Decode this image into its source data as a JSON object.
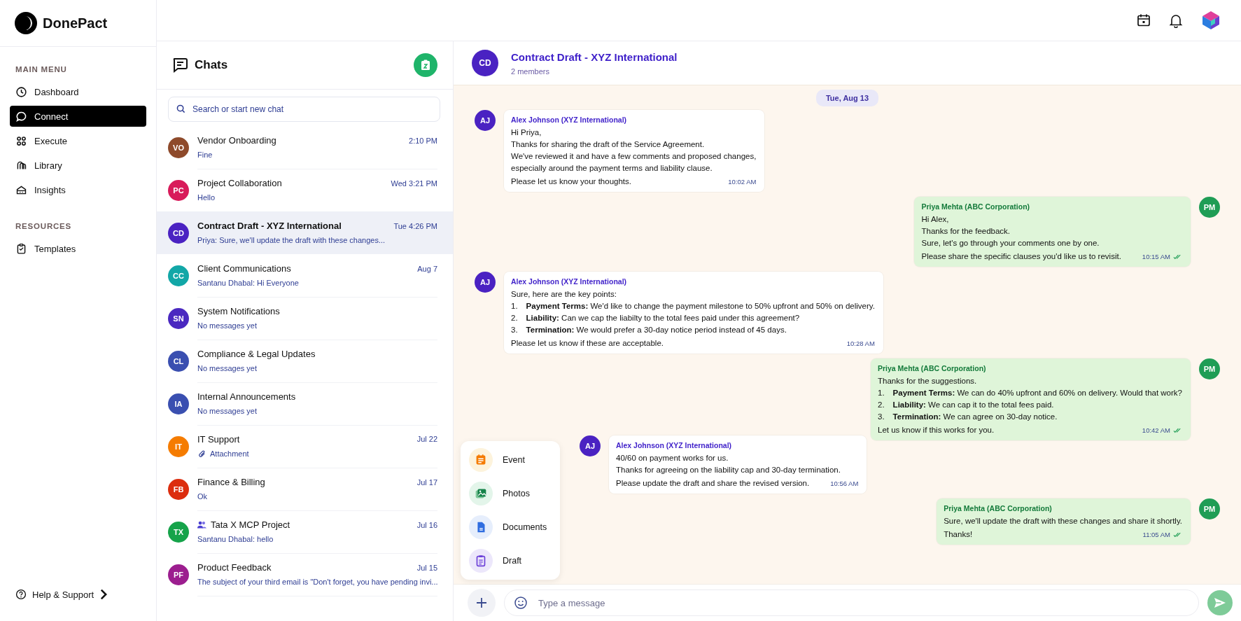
{
  "brand": {
    "name": "DonePact"
  },
  "sidebar": {
    "sections": [
      {
        "title": "MAIN MENU",
        "items": [
          {
            "label": "Dashboard",
            "selected": false
          },
          {
            "label": "Connect",
            "selected": true
          },
          {
            "label": "Execute",
            "selected": false
          },
          {
            "label": "Library",
            "selected": false
          },
          {
            "label": "Insights",
            "selected": false
          }
        ]
      },
      {
        "title": "RESOURCES",
        "items": [
          {
            "label": "Templates",
            "selected": false
          }
        ]
      }
    ],
    "help": "Help & Support"
  },
  "chat_list": {
    "title": "Chats",
    "search": {
      "placeholder": "Search or start new chat"
    },
    "chats": [
      {
        "initials": "VO",
        "color": "#8e4a2b",
        "name": "Vendor Onboarding",
        "time": "2:10 PM",
        "preview": "Fine",
        "kind": "text",
        "selected": false
      },
      {
        "initials": "PC",
        "color": "#d81b5a",
        "name": "Project Collaboration",
        "time": "Wed 3:21 PM",
        "preview": "Hello",
        "kind": "text",
        "selected": false
      },
      {
        "initials": "CD",
        "color": "#4a22c2",
        "name": "Contract Draft - XYZ International",
        "time": "Tue 4:26 PM",
        "preview": "Priya: Sure, we'll update the draft with these changes...",
        "kind": "text",
        "selected": true
      },
      {
        "initials": "CC",
        "color": "#12a7a7",
        "name": "Client Communications",
        "time": "Aug 7",
        "preview": "Santanu Dhabal: Hi Everyone",
        "kind": "text",
        "selected": false
      },
      {
        "initials": "SN",
        "color": "#4a28c0",
        "name": "System Notifications",
        "preview": "No messages yet",
        "kind": "text",
        "selected": false
      },
      {
        "initials": "CL",
        "color": "#3a4fb0",
        "name": "Compliance & Legal Updates",
        "preview": "No messages yet",
        "kind": "text",
        "selected": false
      },
      {
        "initials": "IA",
        "color": "#3a4fb0",
        "name": "Internal Announcements",
        "preview": "No messages yet",
        "kind": "text",
        "selected": false
      },
      {
        "initials": "IT",
        "color": "#f57c00",
        "name": "IT Support",
        "time": "Jul 22",
        "preview": "Attachment",
        "kind": "attachment",
        "selected": false
      },
      {
        "initials": "FB",
        "color": "#dc2d0e",
        "name": "Finance & Billing",
        "time": "Jul 17",
        "preview": "Ok",
        "kind": "text",
        "selected": false
      },
      {
        "initials": "TX",
        "color": "#16a34a",
        "name": "Tata X MCP Project",
        "time": "Jul 16",
        "preview": "Santanu Dhabal: hello",
        "kind": "group",
        "selected": false
      },
      {
        "initials": "PF",
        "color": "#9c1e8f",
        "name": "Product Feedback",
        "time": "Jul 15",
        "preview": "The subject of your third email is \"Don't forget, you have pending invi...",
        "kind": "text",
        "selected": false
      }
    ]
  },
  "conversation": {
    "initials": "CD",
    "title": "Contract Draft - XYZ International",
    "subtitle": "2 members",
    "date": "Tue, Aug 13",
    "messages": [
      {
        "kind": "in",
        "initials": "AJ",
        "sender": "Alex Johnson (XYZ International)",
        "time": "10:02 AM",
        "blocks": [
          {
            "kind": "text",
            "text": "Hi Priya,"
          },
          {
            "kind": "text",
            "text": "Thanks for sharing the draft of the Service Agreement."
          },
          {
            "kind": "text",
            "text": "We've reviewed it and have a few comments and proposed changes,"
          },
          {
            "kind": "text",
            "text": "especially around the payment terms and liability clause."
          },
          {
            "kind": "text",
            "text": "Please let us know your thoughts."
          }
        ]
      },
      {
        "kind": "out",
        "initials": "PM",
        "sender": "Priya Mehta (ABC Corporation)",
        "time": "10:15 AM",
        "read": true,
        "blocks": [
          {
            "kind": "text",
            "text": "Hi Alex,"
          },
          {
            "kind": "text",
            "text": "Thanks for the feedback."
          },
          {
            "kind": "text",
            "text": "Sure, let's go through your comments one by one."
          },
          {
            "kind": "text",
            "text": "Please share the specific clauses you'd like us to revisit."
          }
        ]
      },
      {
        "kind": "in",
        "initials": "AJ",
        "sender": "Alex Johnson (XYZ International)",
        "time": "10:28 AM",
        "blocks": [
          {
            "kind": "text",
            "text": "Sure, here are the key points:"
          },
          {
            "kind": "item",
            "marker": "1.",
            "text": "**Payment Terms:** We'd like to change the payment milestone to 50% upfront and 50% on delivery."
          },
          {
            "kind": "item",
            "marker": "2.",
            "text": "**Liability:** Can we cap the liabilty to the total fees paid under this agreement?"
          },
          {
            "kind": "item",
            "marker": "3.",
            "text": "**Termination:** We would prefer a 30-day notice period instead of 45 days."
          },
          {
            "kind": "text",
            "text": "Please let us know if these are acceptable."
          }
        ]
      },
      {
        "kind": "out",
        "initials": "PM",
        "sender": "Priya Mehta (ABC Corporation)",
        "time": "10:42 AM",
        "read": true,
        "blocks": [
          {
            "kind": "text",
            "text": "Thanks for the suggestions."
          },
          {
            "kind": "item",
            "marker": "1.",
            "text": "**Payment Terms:** We can do 40% upfront and 60% on delivery. Would that work?"
          },
          {
            "kind": "item",
            "marker": "2.",
            "text": "**Liability:** We can cap it to the total fees paid."
          },
          {
            "kind": "item",
            "marker": "3.",
            "text": "**Termination:** We can agree on 30-day notice."
          },
          {
            "kind": "text",
            "text": "Let us know if this works for you."
          }
        ]
      },
      {
        "kind": "in",
        "initials": "AJ",
        "sender": "Alex Johnson (XYZ International)",
        "time": "10:56 AM",
        "blocks": [
          {
            "kind": "text",
            "text": "40/60 on payment works for us."
          },
          {
            "kind": "text",
            "text": "Thanks for agreeing on the liability cap and 30-day termination."
          },
          {
            "kind": "text",
            "text": "Please update the draft and share the revised version."
          }
        ]
      },
      {
        "kind": "out",
        "initials": "PM",
        "sender": "Priya Mehta (ABC Corporation)",
        "time": "11:05 AM",
        "read": true,
        "blocks": [
          {
            "kind": "text",
            "text": "Sure, we'll update the draft with these changes and share it shortly."
          },
          {
            "kind": "text",
            "text": "Thanks!"
          }
        ]
      }
    ],
    "attach_menu": [
      "Event",
      "Photos",
      "Documents",
      "Draft"
    ],
    "composer": {
      "placeholder": "Type a message"
    }
  }
}
